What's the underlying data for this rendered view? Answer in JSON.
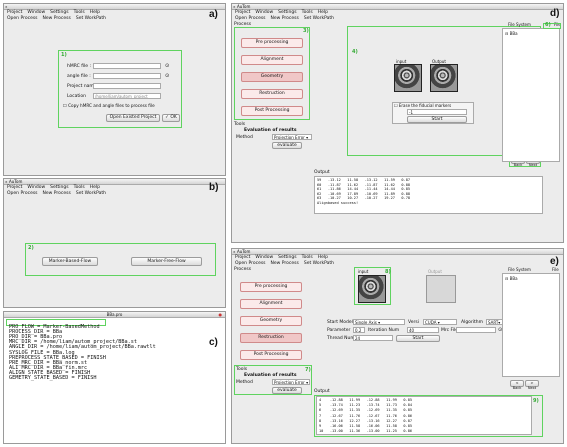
{
  "panels": {
    "a": "a)",
    "b": "b)",
    "c": "c)",
    "d": "d)",
    "e": "e)"
  },
  "menu": [
    "Project",
    "Window",
    "Settings",
    "Tools",
    "Help"
  ],
  "toolbar": [
    "Open Process",
    "New Process",
    "Set WorkPath"
  ],
  "win_a": {
    "box_num": "1)",
    "hmrc_label": "hMRC file :",
    "angle_label": "angle file :",
    "project_name_label": "Project name",
    "location_label": "Location",
    "location_value": "/home/liam/autom_project",
    "copy_label": "Copy hMRC and angle files to process file",
    "open_existed": "Open Existed Project",
    "ok": "OK"
  },
  "win_b": {
    "title": "AuTom",
    "box_num": "2)",
    "marker_based": "Marker-Based-Flow",
    "marker_free": "Marker-Free-Flow"
  },
  "win_c": {
    "title": "BBa.pro",
    "lines": [
      "PRO_FLOW = Marker-BasedMethod",
      "PROCESS_DIR = BBa",
      "PRO_DIR = BBa.pro",
      "MRC_DIR = /home/liam/autom_project/BBa.st",
      "ANGLE_DIR = /home/liam/autom_project/BBa.rawtlt",
      "SYSLOG_FILE = BBa.log",
      "PREPROCESS_STATE_BASED = FINISH",
      "PRE_MRC_DIR = BBa_norm.st",
      "ALI_MRC_DIR = BBa_fin.mrc",
      "ALIGN_STATE_BASED = FINISH",
      "GEMETRY_STATE_BASED = FINISH"
    ]
  },
  "win_d": {
    "title": "AuTom",
    "process_label": "Process",
    "box3": "3)",
    "steps": [
      "Pre processing",
      "Alignment",
      "Geometry",
      "Restruction",
      "Post Processing"
    ],
    "tools_label": "Tools",
    "evaluation": "Evaluation of results",
    "method_label": "Method",
    "method_value": "Projection Error",
    "evaluate": "evaluate",
    "box4": "4)",
    "input_label": "input",
    "output_label": "Output",
    "erase_label": "Erase the fiducial markers",
    "erase_value": "-1",
    "start": "Start",
    "box5": "5)",
    "back": "< Back",
    "next": "> Next",
    "output_title": "Output",
    "output_lines": [
      "59   -13.12   11.58   -13.12   11.59   0.87",
      "60   -11.87   11.62   -11.87   11.62   0.88",
      "61   -11.86   14.44   -11.44   14.44   0.85",
      "62   -10.69   17.89   -10.69   11.89   0.88",
      "63   -10.27   10.27   -10.27   19.27   0.78",
      "Alignbased success!"
    ],
    "file_system": "File System",
    "box6": "6)",
    "file_tab": "File",
    "tree_item": "BBa"
  },
  "win_e": {
    "title": "AuTom",
    "process_label": "Process",
    "steps": [
      "Pre processing",
      "Alignment",
      "Geometry",
      "Restruction",
      "Post Processing"
    ],
    "input_label": "input",
    "output_label": "Output",
    "box8": "8)",
    "start_model_label": "Start Model",
    "start_model_value": "Single Axis",
    "vers_label": "Versi",
    "vers_value": "CUDA",
    "algorithm_label": "Algorithm",
    "algorithm_value": "SART",
    "parameter_label": "Parameter",
    "parameter_value": "0.2",
    "iteration_label": "Iteration Num",
    "iteration_value": "40",
    "mrc_file_label": "Mrc File",
    "thread_label": "Thread Num",
    "thread_value": "24",
    "start": "Start",
    "tools_label": "Tools",
    "box7": "7)",
    "evaluation": "Evaluation of results",
    "method_label": "Method",
    "method_value": "Projection Error",
    "evaluate": "evaluate",
    "back": "< Back",
    "next": "> Next",
    "output_title": "Output",
    "box9": "9)",
    "output_lines": [
      "4    -12.88   11.99   -12.88   11.99   0.85",
      "5    -13.74   11.23   -13.74   11.73   0.84",
      "6    -12.69   11.35   -12.69   11.35   0.85",
      "7    -12.67   11.76   -12.67   11.76   0.86",
      "8    -13.16   12.27   -13.16   12.27   0.87",
      "9    -16.06   11.58   -16.06   11.58   0.85",
      "10   -13.00   11.36   -13.00   11.25   0.86"
    ],
    "file_system": "File System",
    "file_tab": "File",
    "tree_item": "BBa"
  }
}
